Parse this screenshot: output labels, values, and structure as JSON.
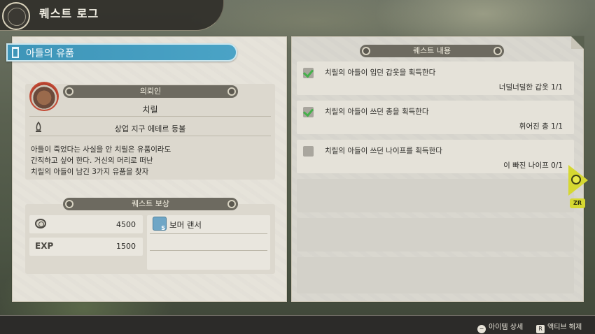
{
  "header": {
    "title": "퀘스트 로그"
  },
  "quest": {
    "title": "아들의 유품"
  },
  "client": {
    "section_label": "의뢰인",
    "name": "치릴",
    "location": "상업 지구 에테르 등불",
    "description": [
      "아들이 죽었다는 사실을 안 치릴은 유품이라도",
      "간직하고 싶어 한다. 거신의 머리로 떠난",
      "치릴의 아들이 남긴 3가지 유품을 찾자"
    ]
  },
  "rewards": {
    "section_label": "퀘스트 보상",
    "gold": "4500",
    "exp_label": "EXP",
    "exp": "1500",
    "item_name": "보머 랜서"
  },
  "objectives": {
    "section_label": "퀘스트 내용",
    "items": [
      {
        "text": "치릴의 아들이 입던 갑옷을 획득한다",
        "count": "너덜너덜한 갑옷 1/1",
        "done": true
      },
      {
        "text": "치릴의 아들이 쓰던 총을 획득한다",
        "count": "휘어진 총 1/1",
        "done": true
      },
      {
        "text": "치릴의 아들이 쓰던 나이프를 획득한다",
        "count": "이 빠진 나이프 0/1",
        "done": false
      }
    ]
  },
  "nav": {
    "zr_label": "ZR"
  },
  "footer": {
    "hint1_button": "−",
    "hint1": "아이템 상세",
    "hint2_button": "R",
    "hint2": "액티브 해제"
  },
  "colors": {
    "accent_blue": "#4aa3c6",
    "check_green": "#44b04a",
    "nav_yellow": "#d6d831"
  }
}
